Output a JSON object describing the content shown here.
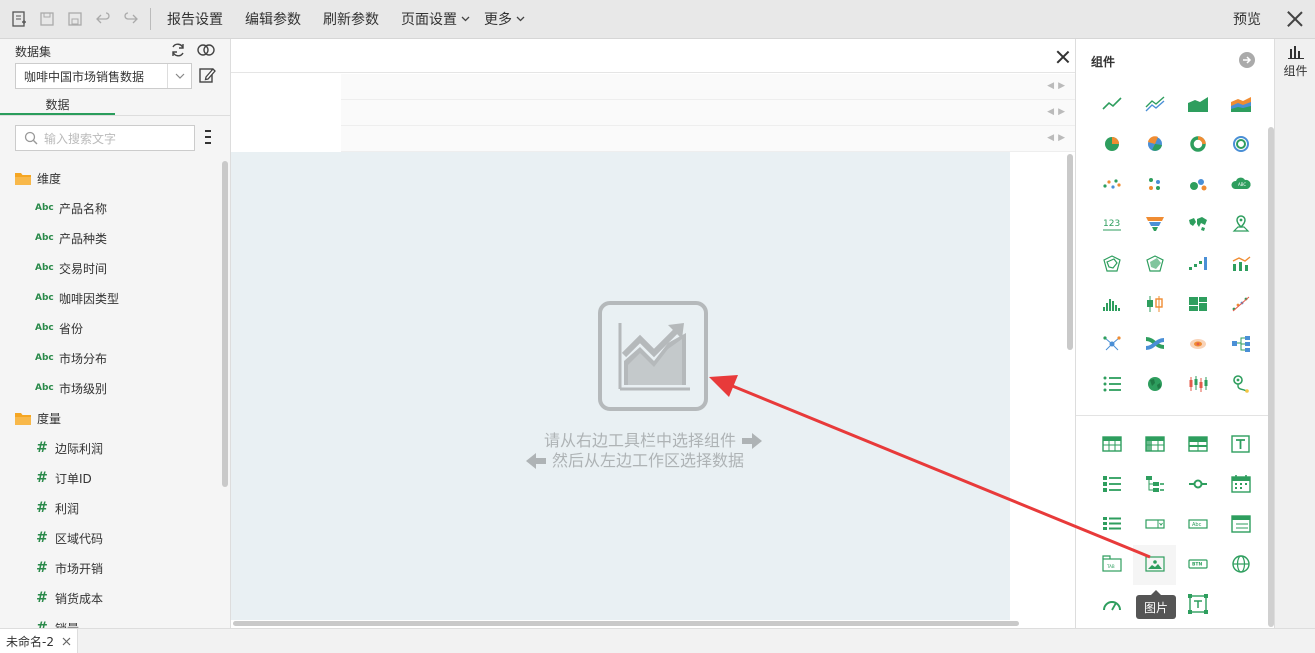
{
  "toolbar": {
    "report_settings": "报告设置",
    "edit_params": "编辑参数",
    "refresh_params": "刷新参数",
    "page_settings": "页面设置",
    "more": "更多",
    "preview": "预览"
  },
  "left_panel": {
    "dataset_label": "数据集",
    "dataset_value": "咖啡中国市场销售数据",
    "tab_data": "数据",
    "search_placeholder": "输入搜索文字",
    "dimension_folder": "维度",
    "dimensions": [
      "产品名称",
      "产品种类",
      "交易时间",
      "咖啡因类型",
      "省份",
      "市场分布",
      "市场级别"
    ],
    "measure_folder": "度量",
    "measures": [
      "边际利润",
      "订单ID",
      "利润",
      "区域代码",
      "市场开销",
      "销货成本",
      "销量"
    ],
    "type_badge": "Abc",
    "measure_badge": "#"
  },
  "canvas": {
    "hint_line1": "请从右边工具栏中选择组件",
    "hint_line2": "然后从左边工作区选择数据"
  },
  "component_panel": {
    "title": "组件",
    "tooltip": "图片",
    "chart_icons": [
      "line-chart-icon",
      "multi-line-chart-icon",
      "area-chart-icon",
      "stacked-area-chart-icon",
      "pie-chart-icon",
      "rose-pie-chart-icon",
      "donut-chart-icon",
      "ring-chart-icon",
      "scatter-chart-icon",
      "dot-matrix-chart-icon",
      "bubble-chart-icon",
      "word-cloud-icon",
      "kpi-number-icon",
      "funnel-chart-icon",
      "world-map-icon",
      "geo-point-map-icon",
      "radar-chart-icon",
      "filled-radar-chart-icon",
      "waterfall-chart-icon",
      "combo-chart-icon",
      "histogram-chart-icon",
      "boxplot-chart-icon",
      "treemap-chart-icon",
      "scatter-trend-icon",
      "network-graph-icon",
      "sankey-chart-icon",
      "heat-map-icon",
      "tree-diagram-icon",
      "list-chart-icon",
      "globe-chart-icon",
      "candlestick-chart-icon",
      "route-map-icon"
    ],
    "control_icons": [
      "table-icon",
      "crosstab-icon",
      "freestyle-table-icon",
      "text-box-icon",
      "list-filter-icon",
      "tree-filter-icon",
      "slider-filter-icon",
      "calendar-filter-icon",
      "dropdown-list-icon",
      "combo-box-icon",
      "input-box-icon",
      "form-icon",
      "tab-container-icon",
      "image-icon",
      "button-icon",
      "web-page-icon",
      "gauge-icon",
      "",
      "frame-icon",
      ""
    ]
  },
  "side_strip": {
    "component_tab": "组件"
  },
  "bottom": {
    "sheet_name": "未命名-2"
  },
  "colors": {
    "accent_green": "#2a9d5c",
    "chart_green": "#2e9e5e",
    "chart_blue": "#4a8fd6",
    "chart_orange": "#f08c32",
    "arrow_red": "#e83a3a",
    "work_bg": "#e9f0f3"
  }
}
